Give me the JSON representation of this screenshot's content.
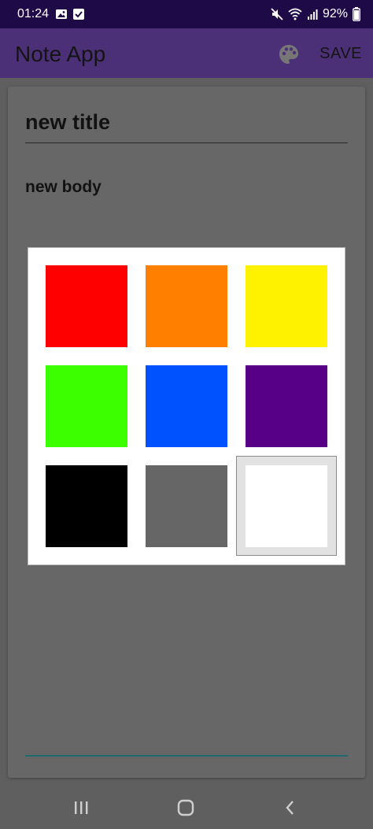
{
  "status_bar": {
    "time": "01:24",
    "battery": "92%",
    "icons": [
      "image-icon",
      "check-box-icon",
      "mute-icon",
      "wifi-icon",
      "signal-icon",
      "battery-icon"
    ]
  },
  "app_bar": {
    "title": "Note App",
    "save_label": "SAVE",
    "palette_icon": "palette-icon"
  },
  "note": {
    "title": "new title",
    "body": "new body"
  },
  "color_picker": {
    "colors": [
      "#ff0000",
      "#ff8000",
      "#fff200",
      "#3cff00",
      "#0052ff",
      "#570087",
      "#000000",
      "#666666",
      "#ffffff"
    ],
    "selected_index": 8
  },
  "colors": {
    "status_bar": "#1f0a48",
    "app_bar": "#4b3077",
    "background": "#5f5f5f",
    "card": "#676767",
    "accent_underline": "#1f6a70"
  },
  "nav_bar": {
    "icons": [
      "recent-apps-icon",
      "home-icon",
      "back-icon"
    ]
  }
}
